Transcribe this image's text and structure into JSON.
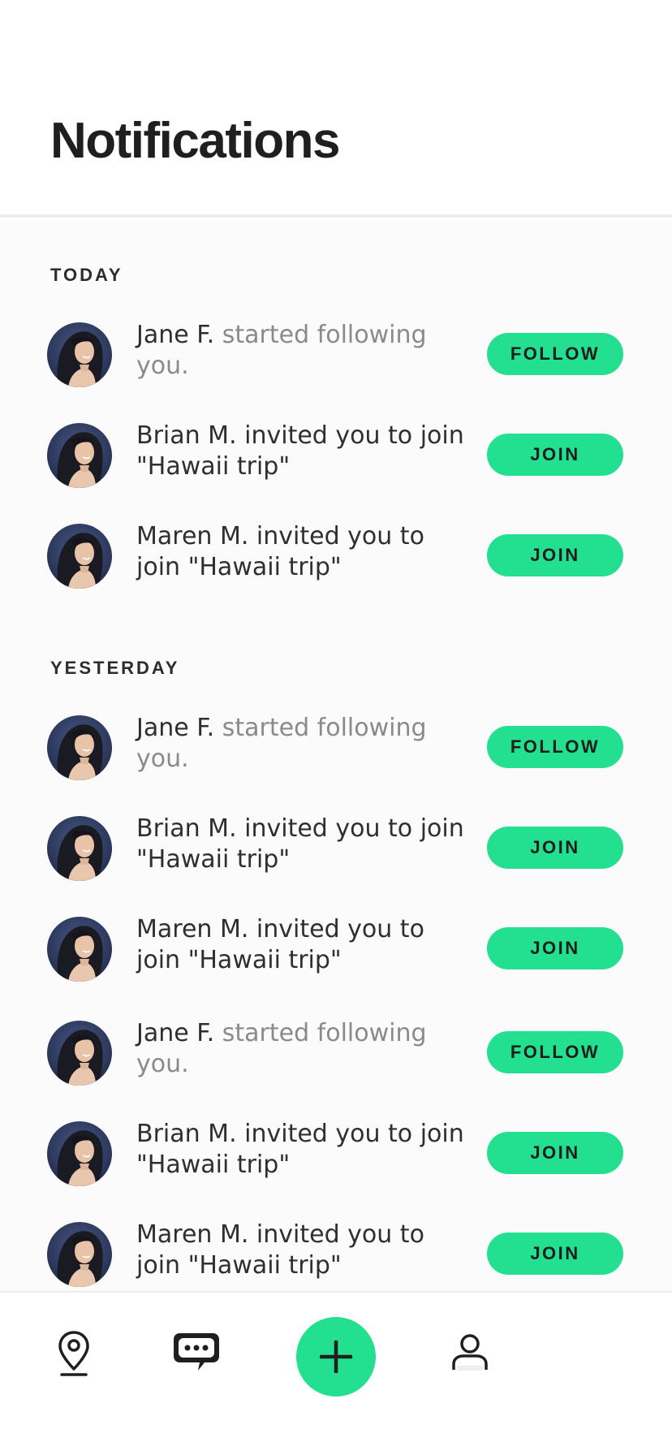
{
  "header": {
    "title": "Notifications"
  },
  "sections": [
    {
      "label": "TODAY",
      "items": [
        {
          "name": "Jane F.",
          "text": " started following you.",
          "text_muted": true,
          "action": "FOLLOW"
        },
        {
          "name": "Brian M.",
          "text": " invited you to join \"Hawaii trip\"",
          "text_muted": false,
          "action": "JOIN"
        },
        {
          "name": "Maren M.",
          "text": " invited you to join \"Hawaii trip\"",
          "text_muted": false,
          "action": "JOIN"
        }
      ]
    },
    {
      "label": "YESTERDAY",
      "items": [
        {
          "name": "Jane F.",
          "text": " started following you.",
          "text_muted": true,
          "action": "FOLLOW"
        },
        {
          "name": "Brian M.",
          "text": " invited you to join \"Hawaii trip\"",
          "text_muted": false,
          "action": "JOIN"
        },
        {
          "name": "Maren M.",
          "text": " invited you to join \"Hawaii trip\"",
          "text_muted": false,
          "action": "JOIN"
        },
        {
          "name": "Jane F.",
          "text": " started following you.",
          "text_muted": true,
          "action": "FOLLOW"
        },
        {
          "name": "Brian M.",
          "text": " invited you to join \"Hawaii trip\"",
          "text_muted": false,
          "action": "JOIN"
        },
        {
          "name": "Maren M.",
          "text": " invited you to join \"Hawaii trip\"",
          "text_muted": false,
          "action": "JOIN"
        }
      ]
    }
  ],
  "tabbar": {
    "tabs": [
      {
        "icon": "location-pin-icon"
      },
      {
        "icon": "chat-bubble-icon"
      },
      {
        "icon": "plus-icon"
      },
      {
        "icon": "profile-icon"
      }
    ]
  },
  "colors": {
    "accent": "#22e08f",
    "muted_text": "#8a8a8a",
    "primary_text": "#2f2f2f"
  }
}
